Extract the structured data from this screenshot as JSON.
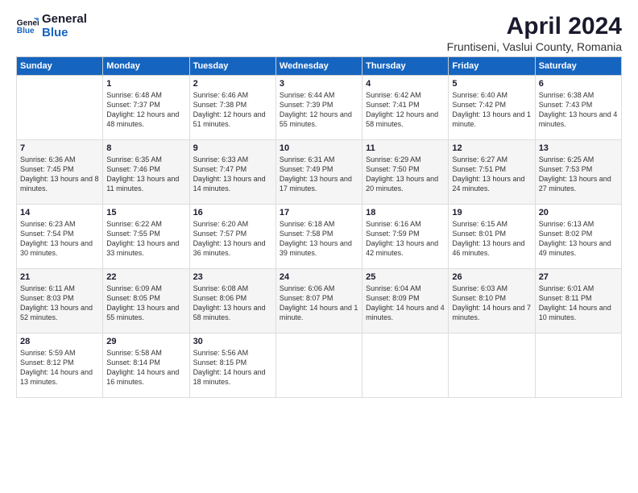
{
  "logo": {
    "general": "General",
    "blue": "Blue"
  },
  "title": "April 2024",
  "location": "Fruntiseni, Vaslui County, Romania",
  "headers": [
    "Sunday",
    "Monday",
    "Tuesday",
    "Wednesday",
    "Thursday",
    "Friday",
    "Saturday"
  ],
  "weeks": [
    [
      {
        "day": "",
        "sunrise": "",
        "sunset": "",
        "daylight": ""
      },
      {
        "day": "1",
        "sunrise": "Sunrise: 6:48 AM",
        "sunset": "Sunset: 7:37 PM",
        "daylight": "Daylight: 12 hours and 48 minutes."
      },
      {
        "day": "2",
        "sunrise": "Sunrise: 6:46 AM",
        "sunset": "Sunset: 7:38 PM",
        "daylight": "Daylight: 12 hours and 51 minutes."
      },
      {
        "day": "3",
        "sunrise": "Sunrise: 6:44 AM",
        "sunset": "Sunset: 7:39 PM",
        "daylight": "Daylight: 12 hours and 55 minutes."
      },
      {
        "day": "4",
        "sunrise": "Sunrise: 6:42 AM",
        "sunset": "Sunset: 7:41 PM",
        "daylight": "Daylight: 12 hours and 58 minutes."
      },
      {
        "day": "5",
        "sunrise": "Sunrise: 6:40 AM",
        "sunset": "Sunset: 7:42 PM",
        "daylight": "Daylight: 13 hours and 1 minute."
      },
      {
        "day": "6",
        "sunrise": "Sunrise: 6:38 AM",
        "sunset": "Sunset: 7:43 PM",
        "daylight": "Daylight: 13 hours and 4 minutes."
      }
    ],
    [
      {
        "day": "7",
        "sunrise": "Sunrise: 6:36 AM",
        "sunset": "Sunset: 7:45 PM",
        "daylight": "Daylight: 13 hours and 8 minutes."
      },
      {
        "day": "8",
        "sunrise": "Sunrise: 6:35 AM",
        "sunset": "Sunset: 7:46 PM",
        "daylight": "Daylight: 13 hours and 11 minutes."
      },
      {
        "day": "9",
        "sunrise": "Sunrise: 6:33 AM",
        "sunset": "Sunset: 7:47 PM",
        "daylight": "Daylight: 13 hours and 14 minutes."
      },
      {
        "day": "10",
        "sunrise": "Sunrise: 6:31 AM",
        "sunset": "Sunset: 7:49 PM",
        "daylight": "Daylight: 13 hours and 17 minutes."
      },
      {
        "day": "11",
        "sunrise": "Sunrise: 6:29 AM",
        "sunset": "Sunset: 7:50 PM",
        "daylight": "Daylight: 13 hours and 20 minutes."
      },
      {
        "day": "12",
        "sunrise": "Sunrise: 6:27 AM",
        "sunset": "Sunset: 7:51 PM",
        "daylight": "Daylight: 13 hours and 24 minutes."
      },
      {
        "day": "13",
        "sunrise": "Sunrise: 6:25 AM",
        "sunset": "Sunset: 7:53 PM",
        "daylight": "Daylight: 13 hours and 27 minutes."
      }
    ],
    [
      {
        "day": "14",
        "sunrise": "Sunrise: 6:23 AM",
        "sunset": "Sunset: 7:54 PM",
        "daylight": "Daylight: 13 hours and 30 minutes."
      },
      {
        "day": "15",
        "sunrise": "Sunrise: 6:22 AM",
        "sunset": "Sunset: 7:55 PM",
        "daylight": "Daylight: 13 hours and 33 minutes."
      },
      {
        "day": "16",
        "sunrise": "Sunrise: 6:20 AM",
        "sunset": "Sunset: 7:57 PM",
        "daylight": "Daylight: 13 hours and 36 minutes."
      },
      {
        "day": "17",
        "sunrise": "Sunrise: 6:18 AM",
        "sunset": "Sunset: 7:58 PM",
        "daylight": "Daylight: 13 hours and 39 minutes."
      },
      {
        "day": "18",
        "sunrise": "Sunrise: 6:16 AM",
        "sunset": "Sunset: 7:59 PM",
        "daylight": "Daylight: 13 hours and 42 minutes."
      },
      {
        "day": "19",
        "sunrise": "Sunrise: 6:15 AM",
        "sunset": "Sunset: 8:01 PM",
        "daylight": "Daylight: 13 hours and 46 minutes."
      },
      {
        "day": "20",
        "sunrise": "Sunrise: 6:13 AM",
        "sunset": "Sunset: 8:02 PM",
        "daylight": "Daylight: 13 hours and 49 minutes."
      }
    ],
    [
      {
        "day": "21",
        "sunrise": "Sunrise: 6:11 AM",
        "sunset": "Sunset: 8:03 PM",
        "daylight": "Daylight: 13 hours and 52 minutes."
      },
      {
        "day": "22",
        "sunrise": "Sunrise: 6:09 AM",
        "sunset": "Sunset: 8:05 PM",
        "daylight": "Daylight: 13 hours and 55 minutes."
      },
      {
        "day": "23",
        "sunrise": "Sunrise: 6:08 AM",
        "sunset": "Sunset: 8:06 PM",
        "daylight": "Daylight: 13 hours and 58 minutes."
      },
      {
        "day": "24",
        "sunrise": "Sunrise: 6:06 AM",
        "sunset": "Sunset: 8:07 PM",
        "daylight": "Daylight: 14 hours and 1 minute."
      },
      {
        "day": "25",
        "sunrise": "Sunrise: 6:04 AM",
        "sunset": "Sunset: 8:09 PM",
        "daylight": "Daylight: 14 hours and 4 minutes."
      },
      {
        "day": "26",
        "sunrise": "Sunrise: 6:03 AM",
        "sunset": "Sunset: 8:10 PM",
        "daylight": "Daylight: 14 hours and 7 minutes."
      },
      {
        "day": "27",
        "sunrise": "Sunrise: 6:01 AM",
        "sunset": "Sunset: 8:11 PM",
        "daylight": "Daylight: 14 hours and 10 minutes."
      }
    ],
    [
      {
        "day": "28",
        "sunrise": "Sunrise: 5:59 AM",
        "sunset": "Sunset: 8:12 PM",
        "daylight": "Daylight: 14 hours and 13 minutes."
      },
      {
        "day": "29",
        "sunrise": "Sunrise: 5:58 AM",
        "sunset": "Sunset: 8:14 PM",
        "daylight": "Daylight: 14 hours and 16 minutes."
      },
      {
        "day": "30",
        "sunrise": "Sunrise: 5:56 AM",
        "sunset": "Sunset: 8:15 PM",
        "daylight": "Daylight: 14 hours and 18 minutes."
      },
      {
        "day": "",
        "sunrise": "",
        "sunset": "",
        "daylight": ""
      },
      {
        "day": "",
        "sunrise": "",
        "sunset": "",
        "daylight": ""
      },
      {
        "day": "",
        "sunrise": "",
        "sunset": "",
        "daylight": ""
      },
      {
        "day": "",
        "sunrise": "",
        "sunset": "",
        "daylight": ""
      }
    ]
  ]
}
